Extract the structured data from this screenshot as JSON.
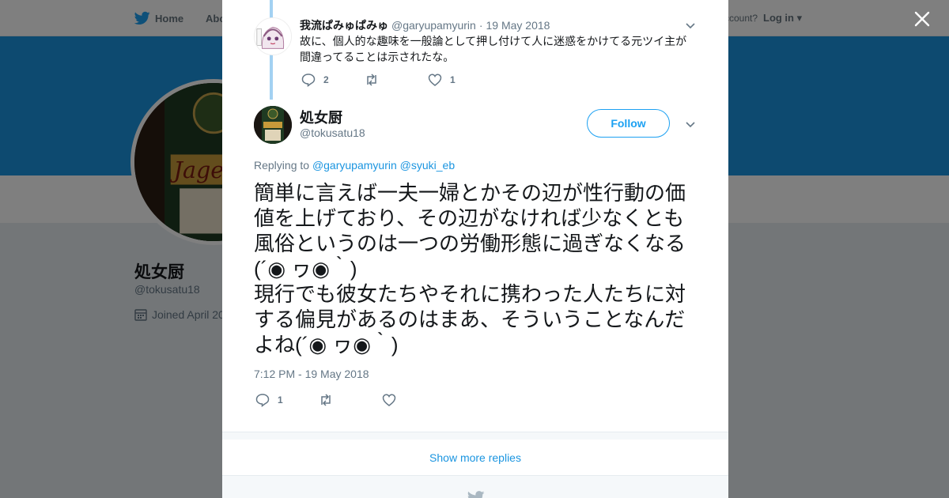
{
  "background": {
    "nav": {
      "home_label": "Home",
      "about_label": "Abo",
      "account_text": "ccount?",
      "login_label": "Log in"
    },
    "profile": {
      "name": "処女厨",
      "handle": "@tokusatu18",
      "joined": "Joined April 20"
    },
    "avatar_text": "Jagerm"
  },
  "modal": {
    "reply": {
      "name": "我流ぱみゅぱみゅ",
      "handle": "@garyupamyurin",
      "separator": "·",
      "date": "19 May 2018",
      "text": "故に、個人的な趣味を一般論として押し付けて人に迷惑をかけてる元ツイ主が間違ってることは示されたな。",
      "reply_count": "2",
      "like_count": "1"
    },
    "main_tweet": {
      "name": "処女厨",
      "handle": "@tokusatu18",
      "follow_label": "Follow",
      "replying_to_label": "Replying to",
      "replying_to_1": "@garyupamyurin",
      "replying_to_2": "@syuki_eb",
      "text_1": "簡単に言えば一夫一婦とかその辺が性行動の価値を上げており、その辺がなければ少なくとも風俗というのは一つの労働形態に過ぎなくなる(´◉ ヮ◉｀)",
      "text_2": "現行でも彼女たちやそれに携わった人たちに対する偏見があるのはまあ、そういうことなんだよね(´◉ ヮ◉｀)",
      "timestamp": "7:12 PM - 19 May 2018",
      "reply_count": "1"
    },
    "show_more_label": "Show more replies"
  },
  "colors": {
    "accent": "#1da1f2",
    "link": "#1b95e0",
    "banner": "#1b95e0",
    "thread_line": "#a3d1f2"
  }
}
